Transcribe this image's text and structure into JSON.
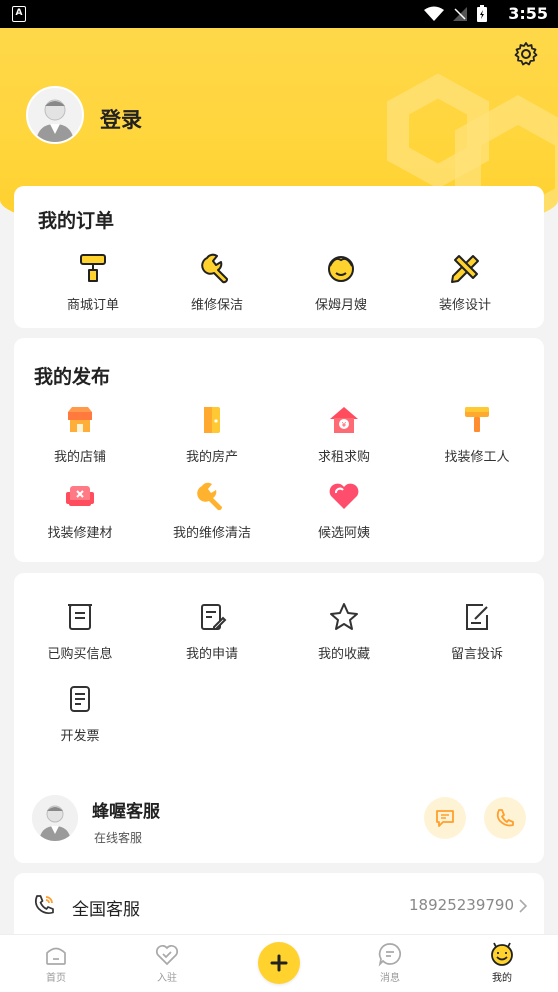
{
  "status_bar": {
    "time": "3:55",
    "badge": "A"
  },
  "profile": {
    "login_label": "登录"
  },
  "orders": {
    "title": "我的订单",
    "items": [
      {
        "label": "商城订单",
        "icon": "paint-roller-icon"
      },
      {
        "label": "维修保洁",
        "icon": "wrench-icon"
      },
      {
        "label": "保姆月嫂",
        "icon": "nanny-face-icon"
      },
      {
        "label": "装修设计",
        "icon": "pencil-ruler-icon"
      }
    ]
  },
  "publish": {
    "title": "我的发布",
    "items": [
      {
        "label": "我的店铺",
        "icon": "shop-icon"
      },
      {
        "label": "我的房产",
        "icon": "door-icon"
      },
      {
        "label": "求租求购",
        "icon": "house-yen-icon"
      },
      {
        "label": "找装修工人",
        "icon": "paint-roller-icon"
      },
      {
        "label": "找装修建材",
        "icon": "sofa-icon"
      },
      {
        "label": "我的维修清洁",
        "icon": "wrench-icon"
      },
      {
        "label": "候选阿姨",
        "icon": "heart-icon"
      }
    ]
  },
  "tools": {
    "items": [
      {
        "label": "已购买信息",
        "icon": "receipt-icon"
      },
      {
        "label": "我的申请",
        "icon": "form-edit-icon"
      },
      {
        "label": "我的收藏",
        "icon": "star-icon"
      },
      {
        "label": "留言投诉",
        "icon": "note-edit-icon"
      },
      {
        "label": "开发票",
        "icon": "invoice-icon"
      }
    ]
  },
  "service": {
    "name": "蜂喔客服",
    "subtitle": "在线客服"
  },
  "hotline": {
    "label": "全国客服",
    "number": "18925239790"
  },
  "tabbar": {
    "items": [
      {
        "label": "首页",
        "icon": "home-icon"
      },
      {
        "label": "入驻",
        "icon": "heart-check-icon"
      },
      {
        "label": "消息",
        "icon": "message-icon"
      },
      {
        "label": "我的",
        "icon": "bee-face-icon"
      }
    ],
    "active": "我的"
  },
  "colors": {
    "brand_yellow": "#ffd53a",
    "accent_orange": "#ff9f2e",
    "accent_red": "#ff4d5e"
  }
}
